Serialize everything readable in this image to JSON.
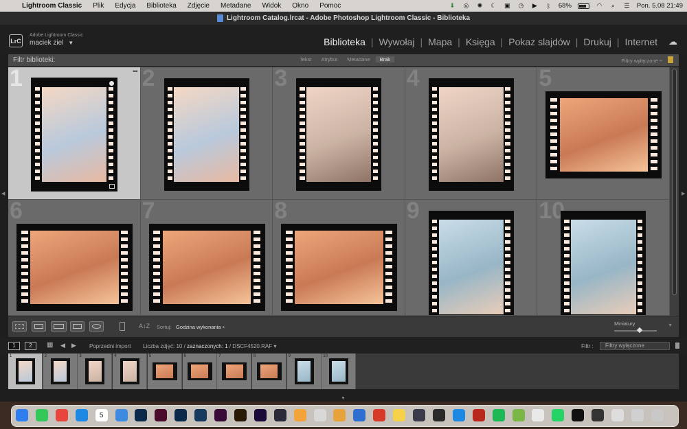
{
  "menubar": {
    "items": [
      "Lightroom Classic",
      "Plik",
      "Edycja",
      "Biblioteka",
      "Zdjęcie",
      "Metadane",
      "Widok",
      "Okno",
      "Pomoc"
    ],
    "battery": "68%",
    "clock": "Pon. 5.08  21:49"
  },
  "window": {
    "title": "Lightroom Catalog.lrcat - Adobe Photoshop Lightroom Classic - Biblioteka"
  },
  "identity": {
    "logo": "LrC",
    "product": "Adobe Lightroom Classic",
    "user": "maciek ziel",
    "user_caret": "▼"
  },
  "modules": [
    "Biblioteka",
    "Wywołaj",
    "Mapa",
    "Księga",
    "Pokaz slajdów",
    "Drukuj",
    "Internet"
  ],
  "active_module": "Biblioteka",
  "filter_bar": {
    "label": "Filtr biblioteki:",
    "tabs": [
      "Tekst",
      "Atrybut",
      "Metadane",
      "Brak"
    ],
    "active_tab": "Brak",
    "right": "Filtry wyłączone ÷"
  },
  "grid": {
    "cells": [
      {
        "index": "1",
        "selected": true,
        "tone": "pale",
        "orient": "portrait"
      },
      {
        "index": "2",
        "selected": false,
        "tone": "pale",
        "orient": "portrait"
      },
      {
        "index": "3",
        "selected": false,
        "tone": "warm",
        "orient": "portrait"
      },
      {
        "index": "4",
        "selected": false,
        "tone": "warm",
        "orient": "portrait"
      },
      {
        "index": "5",
        "selected": false,
        "tone": "orange",
        "orient": "landscape"
      },
      {
        "index": "6",
        "selected": false,
        "tone": "orange",
        "orient": "landscape"
      },
      {
        "index": "7",
        "selected": false,
        "tone": "orange",
        "orient": "landscape"
      },
      {
        "index": "8",
        "selected": false,
        "tone": "orange",
        "orient": "landscape"
      },
      {
        "index": "9",
        "selected": false,
        "tone": "blue",
        "orient": "portrait"
      },
      {
        "index": "10",
        "selected": false,
        "tone": "blue",
        "orient": "portrait"
      }
    ],
    "selected_dots": "•••"
  },
  "toolbar": {
    "sort_label": "Sortuj:",
    "sort_value": "Godzina wykonania ÷",
    "thumb_label": "Miniatury",
    "thumb_size": 0.55
  },
  "filmstrip_bar": {
    "page1": "1",
    "page2": "2",
    "source": "Poprzedni import",
    "count_prefix": "Liczba zdjęć: 10 / ",
    "count_selected": "zaznaczonych: 1",
    "count_file": " / DSCF4520.RAF ▾",
    "filter_label": "Filtr :",
    "filter_value": "Filtry wyłączone"
  },
  "colors": {
    "accent": "#f0f0f0",
    "grid_bg": "#6a6a6a",
    "selected_cell": "#c7c7c7",
    "lock": "#c7a43b"
  },
  "dock": {
    "calendar_day": "5",
    "apps": [
      "finder-icon",
      "messages-icon",
      "chrome-icon",
      "safari-icon",
      "calendar-icon",
      "mail-icon",
      "photoshop-icon",
      "indesign-icon",
      "lightroom-icon",
      "lightroom-classic-icon",
      "xd-icon",
      "bridge-icon",
      "premiere-icon",
      "davinci-icon",
      "photos-icon",
      "preview-icon",
      "sketch-icon",
      "mail-alt-icon",
      "acrobat-icon",
      "notes-icon",
      "affinity-icon",
      "proxy-icon",
      "appstore-icon",
      "filezilla-icon",
      "spotify-icon",
      "android-icon",
      "chatgpt-icon",
      "whatsapp-icon",
      "appletv-icon",
      "scanner-icon",
      "printer-icon",
      "folder-icon",
      "trash-icon"
    ]
  }
}
